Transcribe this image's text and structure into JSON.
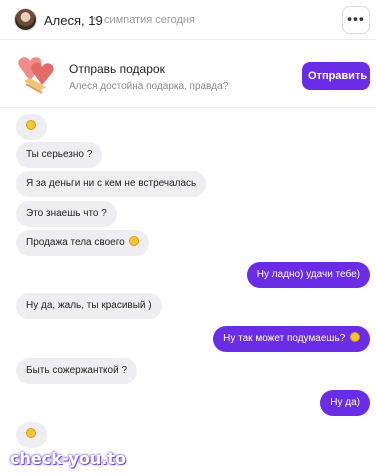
{
  "header": {
    "name": "Алеся, 19",
    "status": "симпатия сегодня",
    "dot": "•",
    "menu": "•••"
  },
  "gift": {
    "title": "Отправь подарок",
    "subtitle": "Алеся достойна подарка, правда?",
    "button": "Отправить"
  },
  "messages": [
    {
      "dir": "in",
      "text": "",
      "emoji": "grin"
    },
    {
      "dir": "in",
      "text": "Ты серьезно ?"
    },
    {
      "dir": "in",
      "text": "Я за деньги ни с кем не встречалась"
    },
    {
      "dir": "in",
      "text": "Это знаешь что ?"
    },
    {
      "dir": "in",
      "text": "Продажа тела своего",
      "emoji": "grin"
    },
    {
      "dir": "out",
      "text": "Ну ладно) удачи тебе)"
    },
    {
      "dir": "in",
      "text": "Ну да, жаль, ты красивый )"
    },
    {
      "dir": "out",
      "text": "Ну так может подумаешь?",
      "emoji": "wink"
    },
    {
      "dir": "in",
      "text": "Быть сожержанткой ?"
    },
    {
      "dir": "out",
      "text": "Ну да)"
    },
    {
      "dir": "in",
      "text": "",
      "emoji": "smile"
    }
  ],
  "watermark": "check-you.to",
  "colors": {
    "accent": "#6b2ce6",
    "incoming_bubble": "#eeeef2"
  }
}
